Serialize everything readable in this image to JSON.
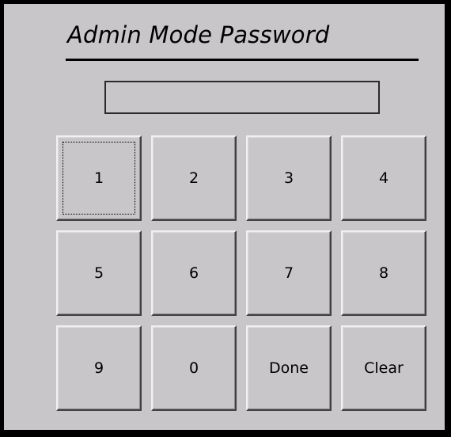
{
  "dialog": {
    "title": "Admin Mode Password",
    "password_value": ""
  },
  "keypad": {
    "keys": [
      "1",
      "2",
      "3",
      "4",
      "5",
      "6",
      "7",
      "8",
      "9",
      "0",
      "Done",
      "Clear"
    ],
    "focused_key": "1"
  },
  "colors": {
    "background": "#c8c6c8",
    "frame": "#000000",
    "text": "#000000"
  }
}
